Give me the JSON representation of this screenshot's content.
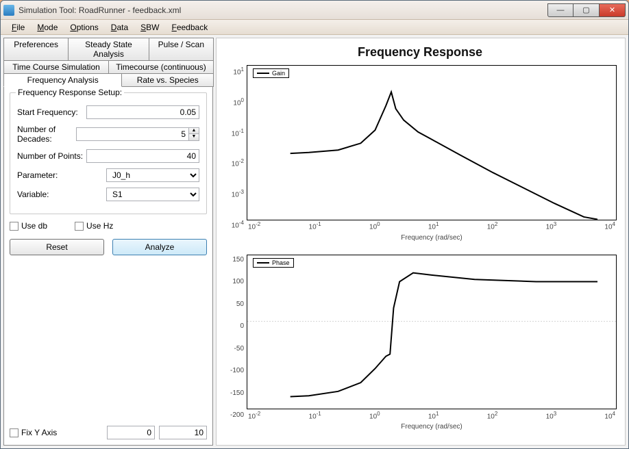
{
  "window": {
    "title": "Simulation Tool: RoadRunner - feedback.xml"
  },
  "menubar": [
    "File",
    "Mode",
    "Options",
    "Data",
    "SBW",
    "Feedback"
  ],
  "tabs": {
    "row1": [
      "Preferences",
      "Steady State Analysis",
      "Pulse / Scan"
    ],
    "row2": [
      "Time Course Simulation",
      "Timecourse (continuous)"
    ],
    "row3": [
      "Frequency Analysis",
      "Rate vs. Species"
    ],
    "active": "Frequency Analysis"
  },
  "freq_setup": {
    "group_title": "Frequency Response Setup:",
    "start_freq_label": "Start Frequency:",
    "start_freq_value": "0.05",
    "num_decades_label": "Number of Decades:",
    "num_decades_value": "5",
    "num_points_label": "Number of Points:",
    "num_points_value": "40",
    "parameter_label": "Parameter:",
    "parameter_value": "J0_h",
    "variable_label": "Variable:",
    "variable_value": "S1"
  },
  "checks": {
    "use_db": "Use db",
    "use_hz": "Use Hz"
  },
  "buttons": {
    "reset": "Reset",
    "analyze": "Analyze"
  },
  "fix_y": {
    "label": "Fix Y Axis",
    "min": "0",
    "max": "10"
  },
  "chart": {
    "title": "Frequency Response",
    "xlabel": "Frequency (rad/sec)",
    "gain_legend": "Gain",
    "phase_legend": "Phase"
  },
  "chart_data": [
    {
      "type": "line",
      "series_name": "Gain",
      "xscale": "log10",
      "yscale": "log10",
      "xlim": [
        0.01,
        10000
      ],
      "ylim": [
        0.0001,
        10
      ],
      "x_ticks": [
        0.01,
        0.1,
        1,
        10,
        100,
        1000,
        10000
      ],
      "y_ticks": [
        0.0001,
        0.001,
        0.01,
        0.1,
        1,
        10
      ],
      "xlabel": "Frequency (rad/sec)",
      "ylabel": "",
      "x": [
        0.05,
        0.1,
        0.3,
        0.7,
        1.2,
        1.8,
        2.2,
        2.6,
        3.5,
        6,
        10,
        30,
        100,
        300,
        1000,
        3000,
        5000
      ],
      "values": [
        0.014,
        0.015,
        0.018,
        0.03,
        0.08,
        0.5,
        1.4,
        0.4,
        0.17,
        0.07,
        0.04,
        0.012,
        0.0033,
        0.0011,
        0.00033,
        0.00012,
        0.0001
      ]
    },
    {
      "type": "line",
      "series_name": "Phase",
      "xscale": "log10",
      "yscale": "linear",
      "xlim": [
        0.01,
        10000
      ],
      "ylim": [
        -200,
        150
      ],
      "x_ticks": [
        0.01,
        0.1,
        1,
        10,
        100,
        1000,
        10000
      ],
      "y_ticks": [
        -200,
        -150,
        -100,
        -50,
        0,
        50,
        100,
        150
      ],
      "xlabel": "Frequency (rad/sec)",
      "ylabel": "",
      "x": [
        0.05,
        0.1,
        0.3,
        0.7,
        1.2,
        1.8,
        2.1,
        2.4,
        3.0,
        5.0,
        10,
        50,
        500,
        5000
      ],
      "values": [
        -172,
        -170,
        -160,
        -140,
        -108,
        -80,
        -75,
        30,
        90,
        110,
        105,
        95,
        90,
        90
      ]
    }
  ]
}
